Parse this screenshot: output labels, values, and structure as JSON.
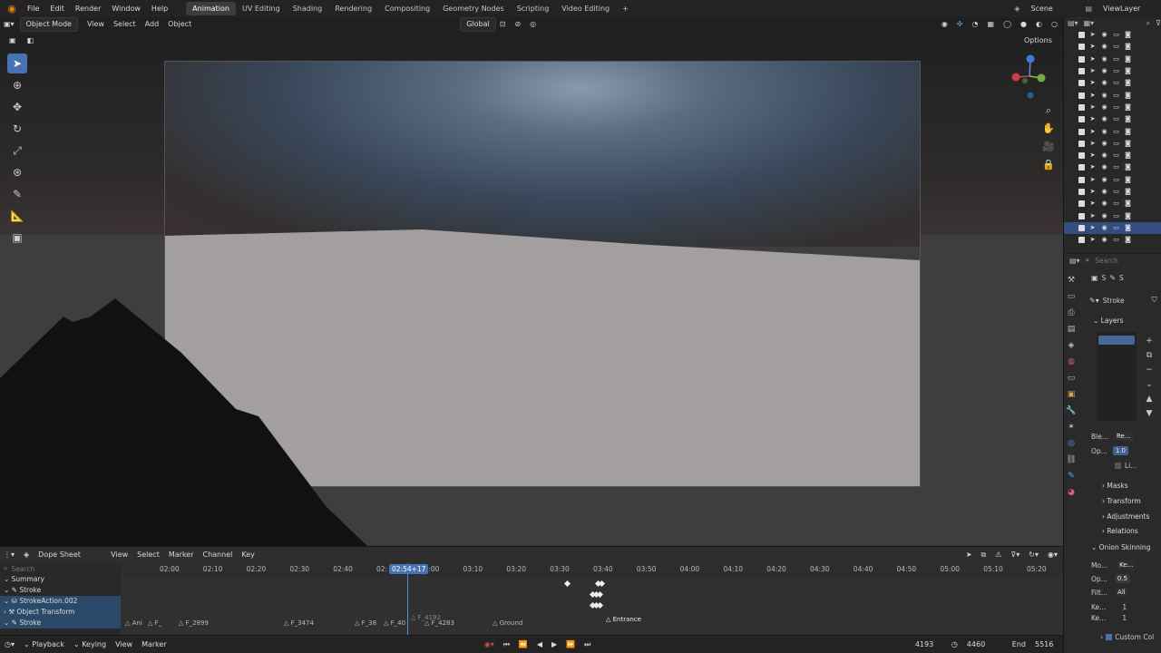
{
  "topbar": {
    "menus": [
      "File",
      "Edit",
      "Render",
      "Window",
      "Help"
    ],
    "workspaces": [
      "Animation",
      "UV Editing",
      "Shading",
      "Rendering",
      "Compositing",
      "Geometry Nodes",
      "Scripting",
      "Video Editing"
    ],
    "active_workspace": "Animation",
    "add_tab": "+",
    "scene": "Scene",
    "view_layer": "ViewLayer"
  },
  "viewport": {
    "mode": "Object Mode",
    "menus": [
      "View",
      "Select",
      "Add",
      "Object"
    ],
    "orientation": "Global",
    "options": "Options"
  },
  "properties": {
    "object_name": "Stroke",
    "layers_label": "Layers",
    "blend_label": "Ble...",
    "blend_value": "Re...",
    "opacity_label": "Op...",
    "opacity_value": "1.0",
    "lights_label": "Li...",
    "masks": "Masks",
    "transform": "Transform",
    "adjustments": "Adjustments",
    "relations": "Relations",
    "onion": "Onion Skinning",
    "onion_mode_label": "Mo...",
    "onion_mode_value": "Ke...",
    "onion_opacity_label": "Op...",
    "onion_opacity_value": "0.5",
    "filter_label": "Filt...",
    "filter_value": "All",
    "keyframes_before_label": "Ke...",
    "keyframes_before_value": "1",
    "keyframes_after_label": "Ke...",
    "keyframes_after_value": "1",
    "custom_colors": "Custom Col",
    "search": "Search"
  },
  "dopesheet": {
    "mode": "Dope Sheet",
    "menus": [
      "View",
      "Select",
      "Marker",
      "Channel",
      "Key"
    ],
    "search_placeholder": "Search",
    "channels": [
      "Summary",
      "Stroke",
      "StrokeAction.002",
      "Object Transform",
      "Stroke"
    ],
    "ticks": [
      "02:00",
      "02:10",
      "02:20",
      "02:30",
      "02:40",
      "02:",
      "03:00",
      "03:10",
      "03:20",
      "03:30",
      "03:40",
      "03:50",
      "04:00",
      "04:10",
      "04:20",
      "04:30",
      "04:40",
      "04:50",
      "05:00",
      "05:10",
      "05:20"
    ],
    "current_time": "02:54+17",
    "markers": [
      "Ani",
      "F_",
      "F_2899",
      "F_3474",
      "F_38",
      "F_40",
      "F_4283",
      "Ground",
      "F_4192",
      "Entrance"
    ]
  },
  "playbar": {
    "playback": "Playback",
    "keying": "Keying",
    "view": "View",
    "marker": "Marker",
    "current_frame": "4193",
    "start_frame": "4460",
    "end_label": "End",
    "end_frame": "5516"
  }
}
